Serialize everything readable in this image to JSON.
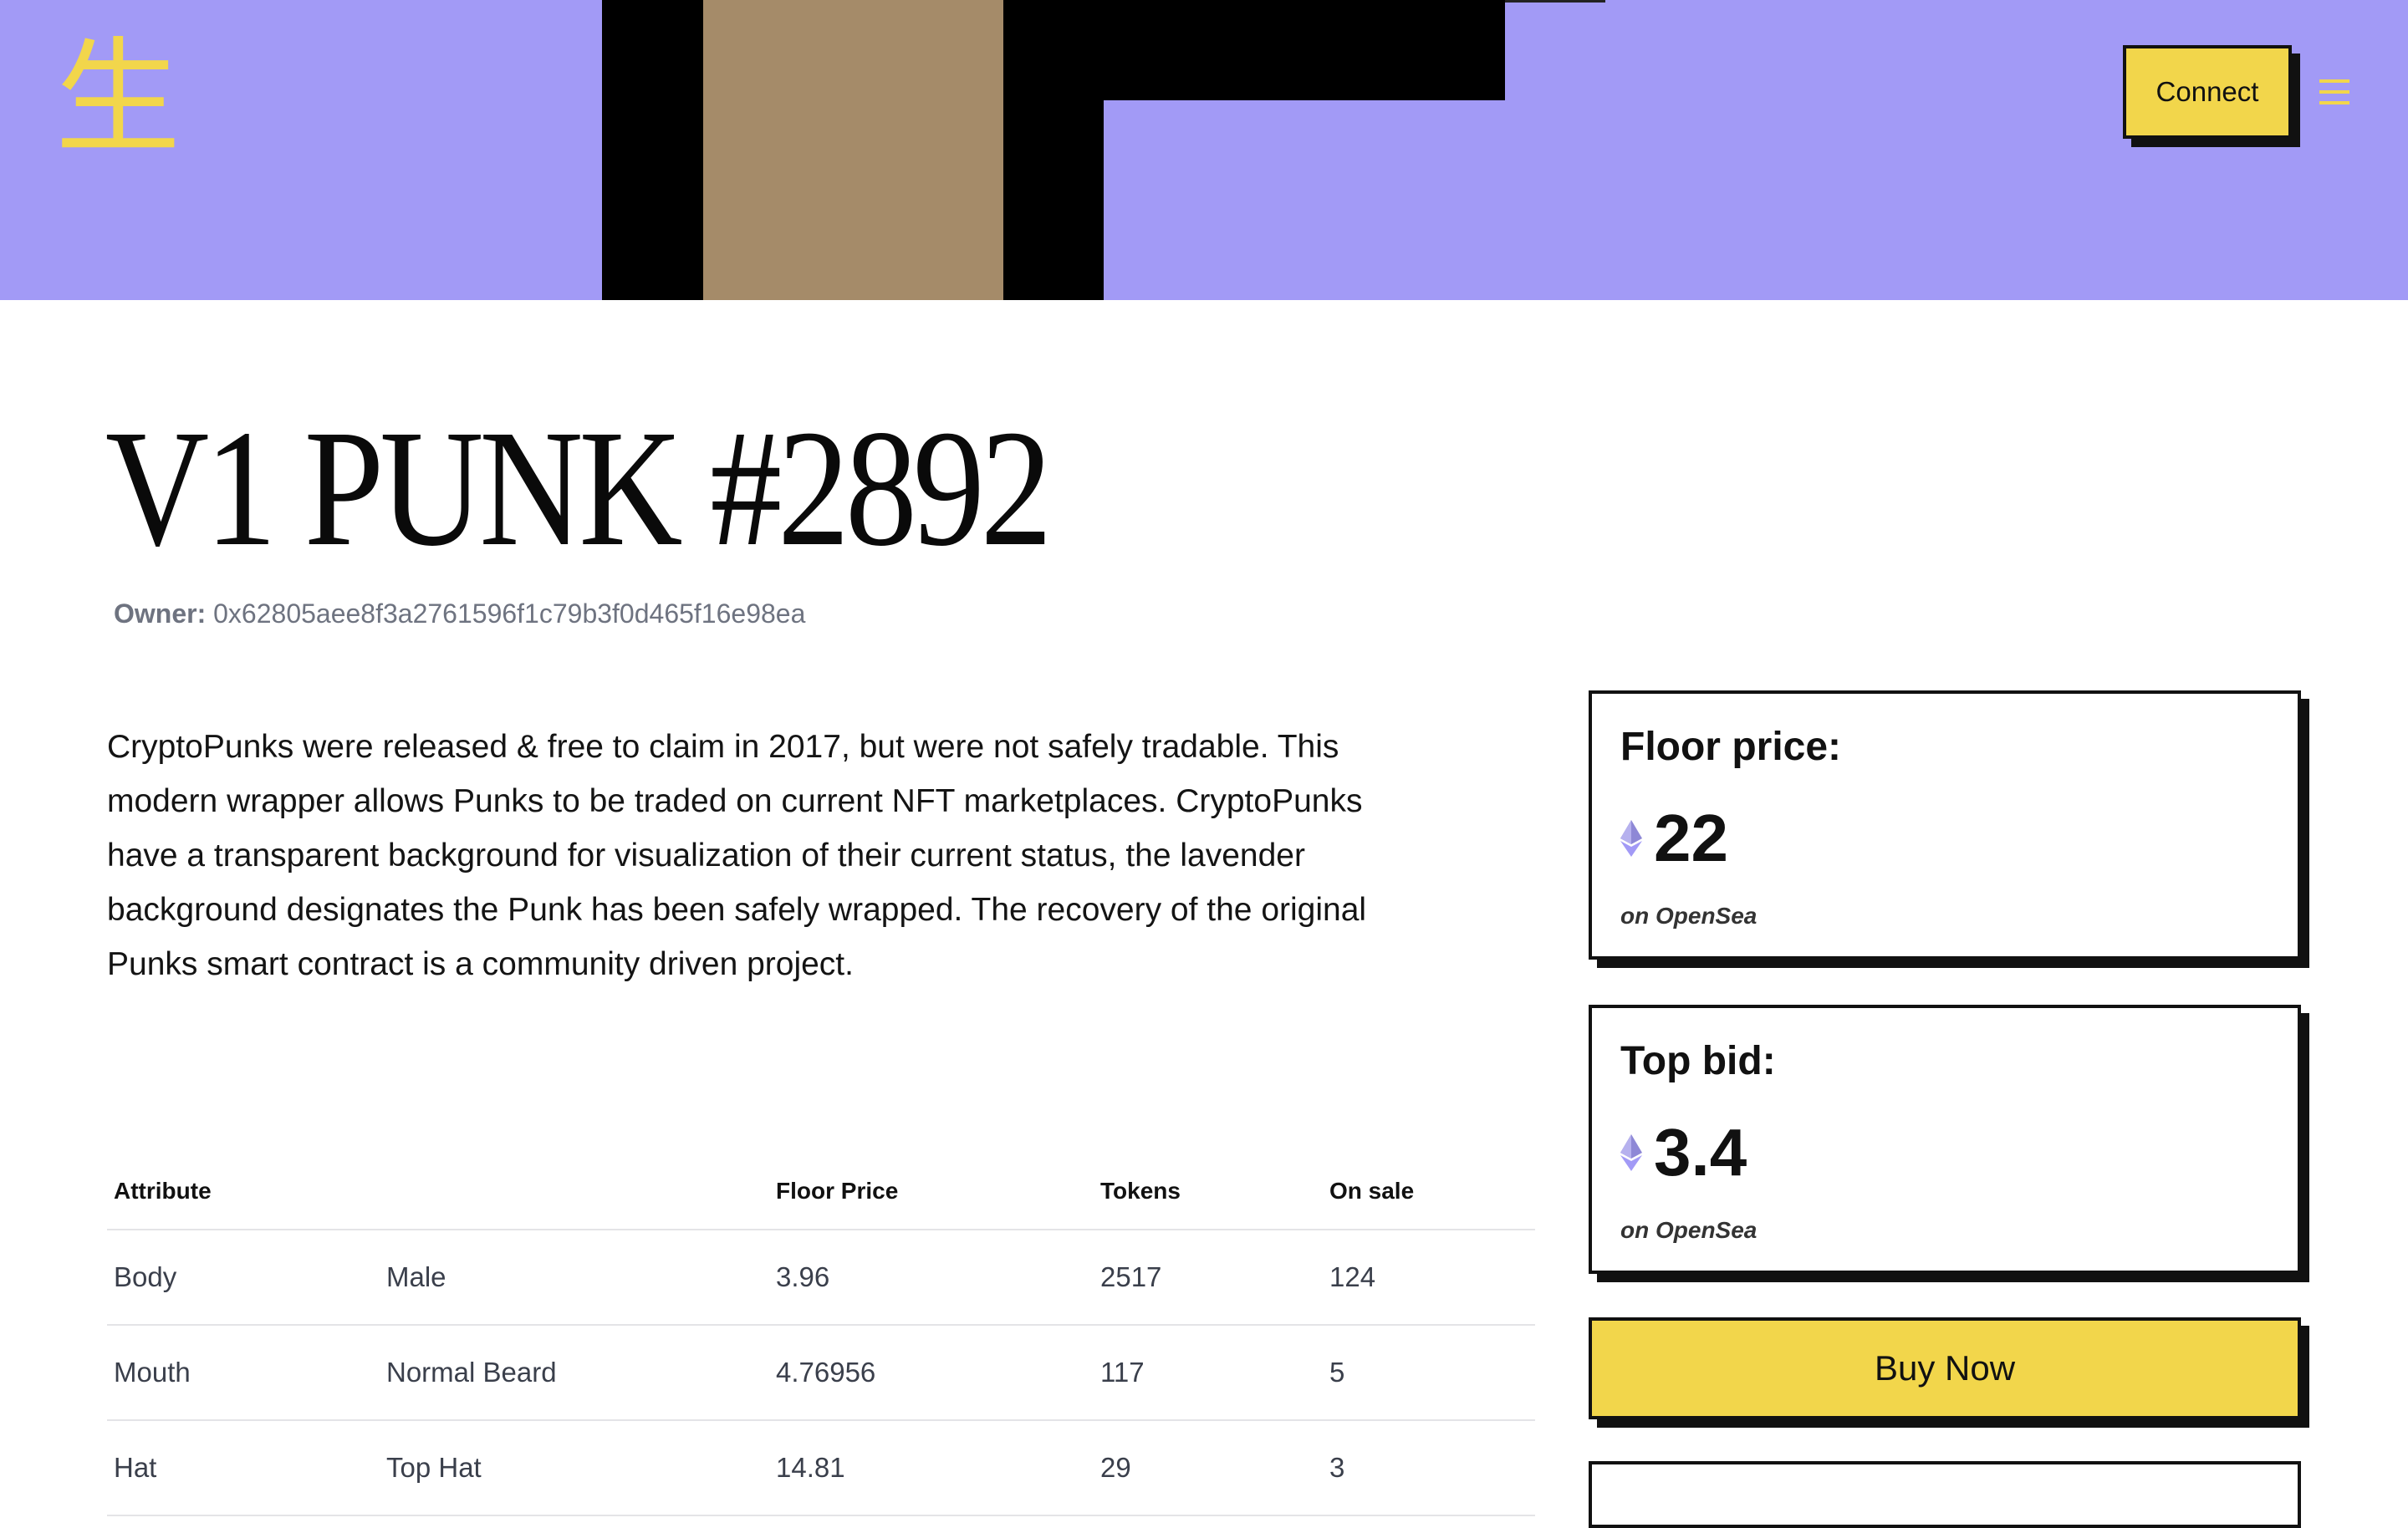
{
  "header": {
    "logo_glyph": "生",
    "connect_label": "Connect",
    "menu_icon": "hamburger-menu-icon",
    "banner_color": "#a29af6",
    "accent_color": "#f2d64b"
  },
  "punk": {
    "title": "V1 PUNK #2892",
    "owner_label": "Owner:",
    "owner_address": "0x62805aee8f3a2761596f1c79b3f0d465f16e98ea",
    "description": "CryptoPunks were released & free to claim in 2017, but were not safely tradable. This modern wrapper allows Punks to be traded on current NFT marketplaces. CryptoPunks have a transparent background for visualization of their current status, the lavender background designates the Punk has been safely wrapped. The recovery of the original Punks smart contract is a community driven project."
  },
  "attributes": {
    "headers": [
      "Attribute",
      "",
      "Floor Price",
      "Tokens",
      "On sale"
    ],
    "rows": [
      {
        "attribute": "Body",
        "value": "Male",
        "floor_price": "3.96",
        "tokens": "2517",
        "on_sale": "124"
      },
      {
        "attribute": "Mouth",
        "value": "Normal Beard",
        "floor_price": "4.76956",
        "tokens": "117",
        "on_sale": "5"
      },
      {
        "attribute": "Hat",
        "value": "Top Hat",
        "floor_price": "14.81",
        "tokens": "29",
        "on_sale": "3"
      }
    ]
  },
  "cards": {
    "floor": {
      "label": "Floor price:",
      "value": "22",
      "source": "on OpenSea",
      "icon": "ethereum-icon"
    },
    "top_bid": {
      "label": "Top bid:",
      "value": "3.4",
      "source": "on OpenSea",
      "icon": "ethereum-icon"
    }
  },
  "buy_now_label": "Buy Now"
}
